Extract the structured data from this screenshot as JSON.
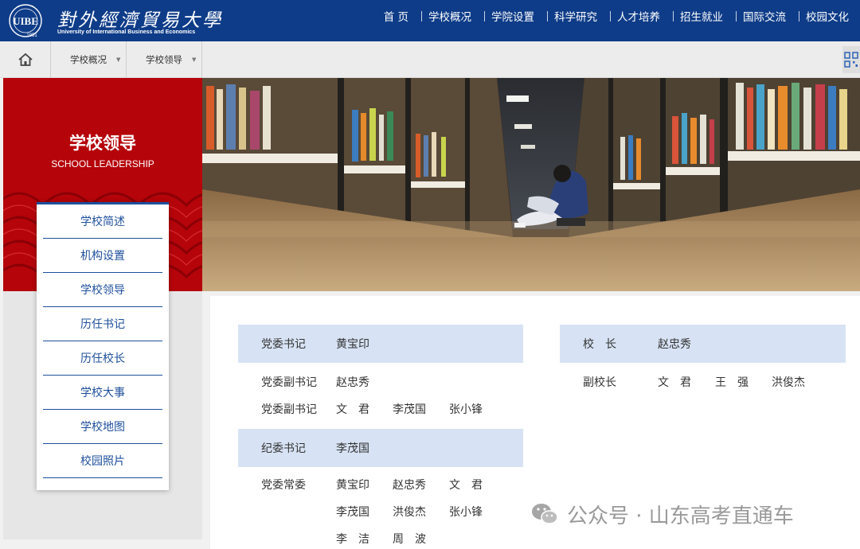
{
  "header": {
    "logo_cn": "對外經濟貿易大學",
    "logo_en": "University of International Business and Economics",
    "logo_year": "1951",
    "nav": [
      "首 页",
      "学校概况",
      "学院设置",
      "科学研究",
      "人才培养",
      "招生就业",
      "国际交流",
      "校园文化"
    ]
  },
  "breadcrumb": {
    "home_icon": "home-icon",
    "items": [
      "学校概况",
      "学校领导"
    ],
    "qr_icon": "qr-code-icon"
  },
  "sidebar": {
    "title": "学校领导",
    "subtitle": "SCHOOL LEADERSHIP",
    "menu": [
      "学校简述",
      "机构设置",
      "学校领导",
      "历任书记",
      "历任校长",
      "学校大事",
      "学校地图",
      "校园照片"
    ]
  },
  "leaders": {
    "party_secretary": {
      "role": "党委书记",
      "name": "黄宝印"
    },
    "deputy_secretaries": [
      {
        "role": "党委副书记",
        "names": [
          "赵忠秀"
        ]
      },
      {
        "role": "党委副书记",
        "names": [
          "文　君",
          "李茂国",
          "张小锋"
        ]
      }
    ],
    "discipline_secretary": {
      "role": "纪委书记",
      "name": "李茂国"
    },
    "standing_committee": {
      "role": "党委常委",
      "names": [
        "黄宝印",
        "赵忠秀",
        "文　君",
        "李茂国",
        "洪俊杰",
        "张小锋",
        "李　洁",
        "周　波"
      ]
    },
    "president": {
      "role": "校　长",
      "name": "赵忠秀"
    },
    "vice_presidents": {
      "role": "副校长",
      "names": [
        "文　君",
        "王　强",
        "洪俊杰"
      ]
    }
  },
  "watermark": {
    "text": "公众号 · 山东高考直通车",
    "icon": "wechat-icon"
  },
  "colors": {
    "header_blue": "#0e3c88",
    "banner_red": "#b5040a",
    "menu_blue": "#1e4f9c",
    "row_highlight": "#d7e3f4"
  }
}
